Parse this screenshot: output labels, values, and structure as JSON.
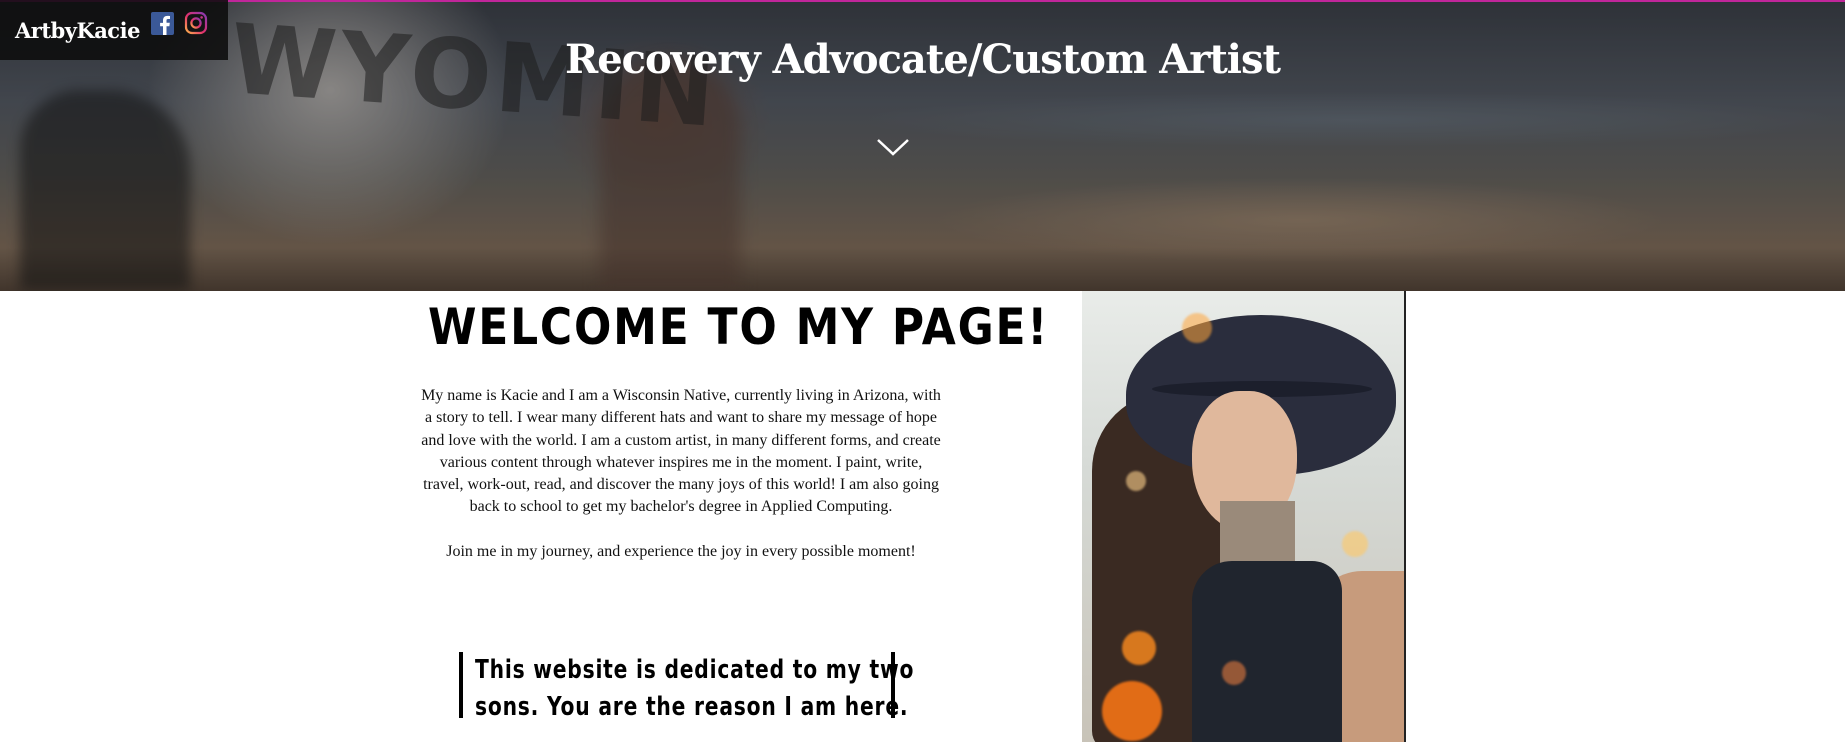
{
  "header": {
    "brand": "ArtbyKacie",
    "social": [
      {
        "name": "facebook",
        "icon": "facebook-icon",
        "color": "#3b5998"
      },
      {
        "name": "instagram",
        "icon": "instagram-icon",
        "color": "#d6249f"
      }
    ],
    "hero_title": "Recovery Advocate/Custom Artist",
    "accent_color": "#c0269a"
  },
  "main": {
    "welcome_heading": "WELCOME TO MY PAGE!",
    "intro_paragraph": "My name is Kacie and I am a Wisconsin Native, currently living in Arizona, with a story to tell.  I wear many different hats and want to share my message of hope and love with the world. I am a custom artist, in many different forms, and create various content through whatever inspires me in the moment. I paint, write, travel, work-out, read, and discover the many joys of this world! I am also going back to school to get my bachelor's degree in Applied Computing.",
    "join_text": "Join me in my journey, and experience the joy in every possible moment!",
    "dedication_line1": "This website is dedicated to my two",
    "dedication_line2": "sons. You are the reason I am here."
  }
}
